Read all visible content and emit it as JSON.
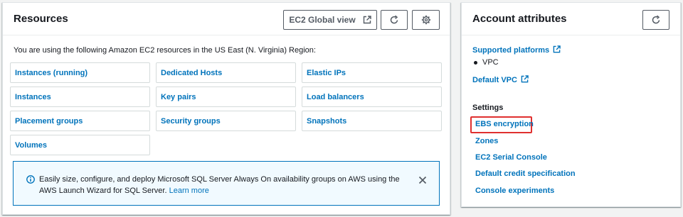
{
  "resources": {
    "title": "Resources",
    "global_view_label": "EC2 Global view",
    "intro": "You are using the following Amazon EC2 resources in the US East (N. Virginia) Region:",
    "items": [
      {
        "label": "Instances (running)"
      },
      {
        "label": "Dedicated Hosts"
      },
      {
        "label": "Elastic IPs"
      },
      {
        "label": "Instances"
      },
      {
        "label": "Key pairs"
      },
      {
        "label": "Load balancers"
      },
      {
        "label": "Placement groups"
      },
      {
        "label": "Security groups"
      },
      {
        "label": "Snapshots"
      },
      {
        "label": "Volumes"
      }
    ],
    "info": {
      "text": "Easily size, configure, and deploy Microsoft SQL Server Always On availability groups on AWS using the AWS Launch Wizard for SQL Server.",
      "link": "Learn more"
    }
  },
  "account": {
    "title": "Account attributes",
    "supported_platforms": "Supported platforms",
    "platform_value": "VPC",
    "default_vpc": "Default VPC",
    "settings_label": "Settings",
    "settings_links": [
      {
        "label": "EBS encryption"
      },
      {
        "label": "Zones"
      },
      {
        "label": "EC2 Serial Console"
      },
      {
        "label": "Default credit specification"
      },
      {
        "label": "Console experiments"
      }
    ]
  },
  "colors": {
    "link": "#0073bb",
    "info_border": "#0073bb",
    "info_bg": "#f1faff",
    "highlight": "#e0302f"
  },
  "icons": [
    "external-link-icon",
    "refresh-icon",
    "gear-icon",
    "info-icon",
    "close-icon"
  ]
}
